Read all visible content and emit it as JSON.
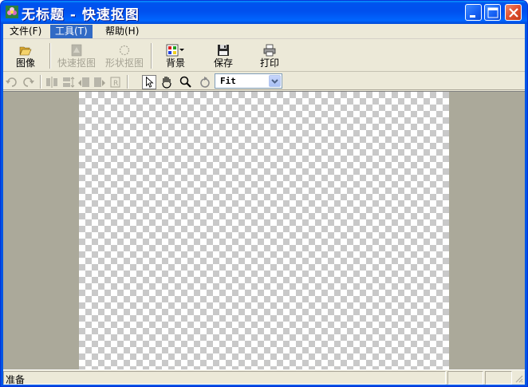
{
  "window": {
    "title": "无标题  -  快速抠图"
  },
  "menu": [
    {
      "label": "文件(F)"
    },
    {
      "label": "工具(T)"
    },
    {
      "label": "帮助(H)"
    }
  ],
  "toolbar": {
    "image_label": "图像",
    "quick_cutout_label": "快速抠图",
    "shape_cutout_label": "形状抠图",
    "background_label": "背景",
    "save_label": "保存",
    "print_label": "打印"
  },
  "zoom": {
    "value": "Fit"
  },
  "status": {
    "text": "准备"
  },
  "colors": {
    "titlebar": "#0055e5",
    "menu_highlight": "#316ac5",
    "workspace": "#aba99a",
    "checker_dark": "#c9c9c9",
    "checker_light": "#ffffff"
  },
  "icons": {
    "app": "app-flower-icon",
    "minimize": "minimize-icon",
    "maximize": "maximize-icon",
    "close": "close-icon",
    "open_image": "folder-open-icon",
    "quick_cutout": "quick-cutout-icon",
    "shape_cutout": "shape-cutout-icon",
    "background": "color-palette-icon",
    "save": "floppy-disk-icon",
    "print": "printer-icon",
    "undo": "undo-icon",
    "redo": "redo-icon",
    "select": "pointer-icon",
    "pan": "hand-icon",
    "zoom": "magnifier-icon",
    "rotate": "rotate-icon"
  }
}
